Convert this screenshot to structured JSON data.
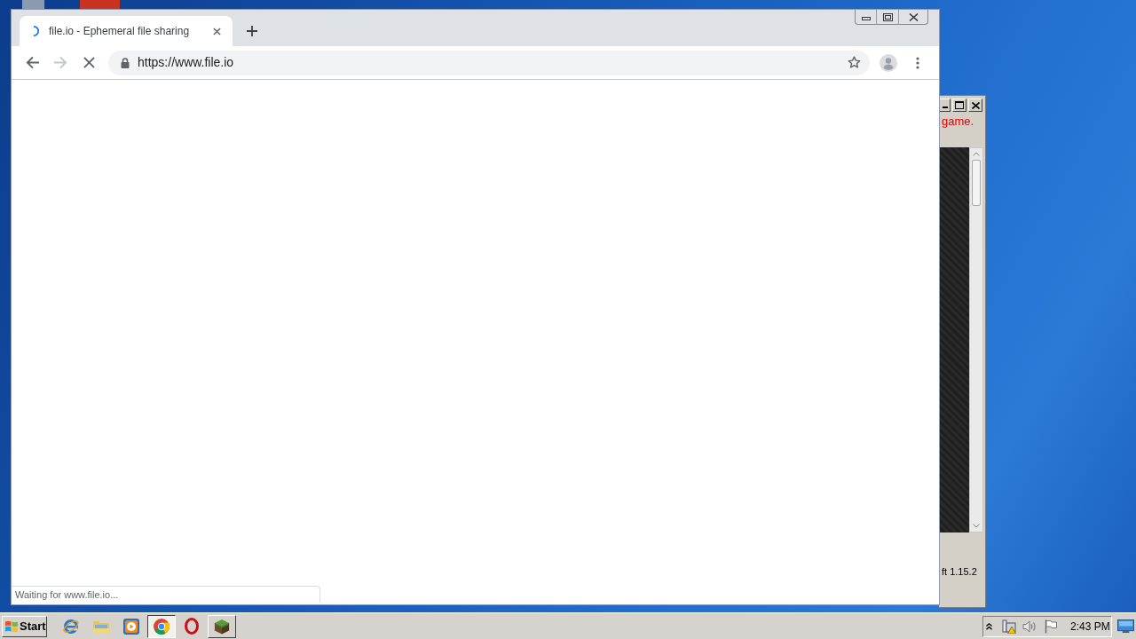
{
  "browser": {
    "tabs": [
      {
        "title": "file.io - Ephemeral file sharing",
        "selected": true
      }
    ],
    "loading": true,
    "forward_disabled": true,
    "address": {
      "url": "https://www.file.io",
      "secure": true
    },
    "status": "Waiting for www.file.io..."
  },
  "background_window": {
    "text_1": "game.",
    "text_2": "ft 1.15.2"
  },
  "taskbar": {
    "start": "Start",
    "apps": [
      {
        "kind": "ie",
        "running": false,
        "selected": false
      },
      {
        "kind": "explorer",
        "running": false,
        "selected": false
      },
      {
        "kind": "media_player",
        "running": false,
        "selected": false
      },
      {
        "kind": "chrome",
        "running": true,
        "selected": true
      },
      {
        "kind": "opera",
        "running": false,
        "selected": false
      },
      {
        "kind": "minecraft",
        "running": true,
        "selected": false
      }
    ],
    "tray": {
      "clock": "2:43 PM"
    }
  }
}
